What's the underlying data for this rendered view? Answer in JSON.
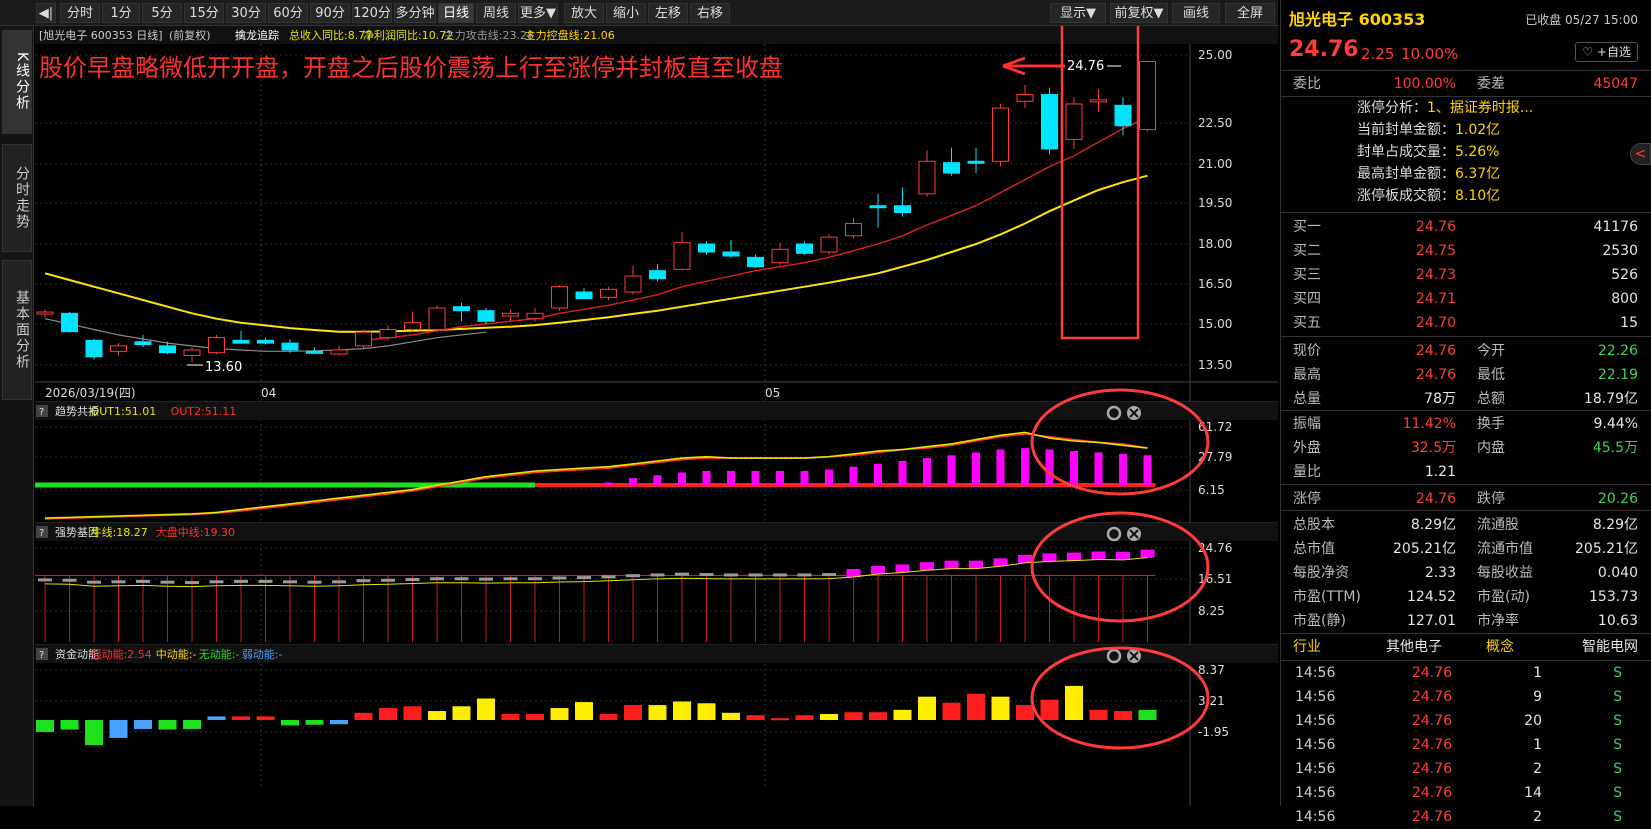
{
  "toolbar": {
    "collapse_icon": "◀|",
    "periods": [
      "分时",
      "1分",
      "5分",
      "15分",
      "30分",
      "60分",
      "90分",
      "120分",
      "多分钟",
      "日线",
      "周线",
      "更多▼"
    ],
    "active_period": "日线",
    "actions": [
      "放大",
      "缩小",
      "左移",
      "右移"
    ],
    "right": [
      "显示▼",
      "前复权▼",
      "画线",
      "全屏"
    ]
  },
  "left_tabs": [
    {
      "label": "K线分析",
      "active": true
    },
    {
      "label": "分时走势",
      "active": false
    },
    {
      "label": "基本面分析",
      "active": false
    }
  ],
  "main_chart": {
    "legend_prefix": "[旭光电子 600353 日线]",
    "adjust": "(前复权)",
    "indicator_name": "擒龙追踪",
    "legend_items": [
      {
        "text": "总收入同比:8.77",
        "color": "#e6e600"
      },
      {
        "text": "净利润同比:10.72",
        "color": "#e6e600"
      },
      {
        "text": "主力攻击线:23.28",
        "color": "#9a9a9a"
      },
      {
        "text": "主力控盘线:21.06",
        "color": "#ffd400"
      }
    ],
    "annotation": "股价早盘略微低开开盘，开盘之后股价震荡上行至涨停并封板直至收盘",
    "high_label": "24.76",
    "low_label": "13.60",
    "y_ticks": [
      "25.00",
      "22.50",
      "21.00",
      "19.50",
      "18.00",
      "16.50",
      "15.00",
      "13.50"
    ],
    "date_labels": [
      "2026/03/19(四)",
      "04",
      "05"
    ]
  },
  "chart_data": {
    "type": "candlestick",
    "ylim": [
      13.5,
      25.0
    ],
    "candles": [
      {
        "o": 15.4,
        "h": 15.55,
        "l": 15.25,
        "c": 15.45
      },
      {
        "o": 15.4,
        "h": 15.45,
        "l": 14.7,
        "c": 14.72
      },
      {
        "o": 14.4,
        "h": 14.45,
        "l": 13.7,
        "c": 13.8
      },
      {
        "o": 14.0,
        "h": 14.3,
        "l": 13.85,
        "c": 14.2
      },
      {
        "o": 14.35,
        "h": 14.6,
        "l": 14.15,
        "c": 14.25
      },
      {
        "o": 14.2,
        "h": 14.35,
        "l": 13.9,
        "c": 13.95
      },
      {
        "o": 13.85,
        "h": 14.15,
        "l": 13.6,
        "c": 14.05
      },
      {
        "o": 13.95,
        "h": 14.6,
        "l": 13.9,
        "c": 14.5
      },
      {
        "o": 14.4,
        "h": 14.75,
        "l": 14.3,
        "c": 14.3
      },
      {
        "o": 14.4,
        "h": 14.5,
        "l": 14.25,
        "c": 14.3
      },
      {
        "o": 14.3,
        "h": 14.45,
        "l": 13.95,
        "c": 14.05
      },
      {
        "o": 14.0,
        "h": 14.15,
        "l": 13.9,
        "c": 13.95
      },
      {
        "o": 13.9,
        "h": 14.2,
        "l": 13.85,
        "c": 14.05
      },
      {
        "o": 14.2,
        "h": 14.8,
        "l": 14.1,
        "c": 14.7
      },
      {
        "o": 14.5,
        "h": 14.95,
        "l": 14.4,
        "c": 14.8
      },
      {
        "o": 14.8,
        "h": 15.45,
        "l": 14.7,
        "c": 15.05
      },
      {
        "o": 14.8,
        "h": 15.7,
        "l": 14.7,
        "c": 15.6
      },
      {
        "o": 15.65,
        "h": 15.8,
        "l": 15.1,
        "c": 15.5
      },
      {
        "o": 15.5,
        "h": 15.6,
        "l": 15.0,
        "c": 15.1
      },
      {
        "o": 15.3,
        "h": 15.55,
        "l": 15.1,
        "c": 15.4
      },
      {
        "o": 15.2,
        "h": 15.6,
        "l": 15.1,
        "c": 15.4
      },
      {
        "o": 15.6,
        "h": 16.45,
        "l": 15.5,
        "c": 16.4
      },
      {
        "o": 16.2,
        "h": 16.35,
        "l": 15.95,
        "c": 15.95
      },
      {
        "o": 16.0,
        "h": 16.4,
        "l": 15.9,
        "c": 16.3
      },
      {
        "o": 16.2,
        "h": 17.2,
        "l": 16.1,
        "c": 16.8
      },
      {
        "o": 17.0,
        "h": 17.25,
        "l": 16.6,
        "c": 16.7
      },
      {
        "o": 17.05,
        "h": 18.45,
        "l": 17.0,
        "c": 18.05
      },
      {
        "o": 18.0,
        "h": 18.1,
        "l": 17.6,
        "c": 17.7
      },
      {
        "o": 17.7,
        "h": 18.15,
        "l": 17.5,
        "c": 17.55
      },
      {
        "o": 17.5,
        "h": 17.6,
        "l": 17.1,
        "c": 17.15
      },
      {
        "o": 17.3,
        "h": 18.05,
        "l": 17.2,
        "c": 17.8
      },
      {
        "o": 18.0,
        "h": 18.1,
        "l": 17.6,
        "c": 17.65
      },
      {
        "o": 17.7,
        "h": 18.35,
        "l": 17.6,
        "c": 18.25
      },
      {
        "o": 18.3,
        "h": 18.95,
        "l": 18.2,
        "c": 18.75
      },
      {
        "o": 19.4,
        "h": 19.85,
        "l": 18.6,
        "c": 19.35
      },
      {
        "o": 19.4,
        "h": 20.1,
        "l": 19.0,
        "c": 19.15
      },
      {
        "o": 19.85,
        "h": 21.5,
        "l": 19.75,
        "c": 21.1
      },
      {
        "o": 21.05,
        "h": 21.6,
        "l": 20.55,
        "c": 20.65
      },
      {
        "o": 21.1,
        "h": 21.6,
        "l": 20.65,
        "c": 21.05
      },
      {
        "o": 21.1,
        "h": 23.2,
        "l": 20.9,
        "c": 23.05
      },
      {
        "o": 23.3,
        "h": 23.9,
        "l": 23.05,
        "c": 23.55
      },
      {
        "o": 23.55,
        "h": 23.8,
        "l": 21.35,
        "c": 21.55
      },
      {
        "o": 21.9,
        "h": 23.45,
        "l": 21.55,
        "c": 23.2
      },
      {
        "o": 23.3,
        "h": 23.75,
        "l": 22.9,
        "c": 23.35
      },
      {
        "o": 23.15,
        "h": 23.45,
        "l": 22.05,
        "c": 22.4
      },
      {
        "o": 22.26,
        "h": 24.76,
        "l": 22.19,
        "c": 24.76
      }
    ],
    "ma_yellow": [
      16.9,
      16.65,
      16.4,
      16.15,
      15.9,
      15.65,
      15.4,
      15.2,
      15.05,
      14.95,
      14.85,
      14.78,
      14.72,
      14.72,
      14.73,
      14.75,
      14.78,
      14.82,
      14.86,
      14.9,
      14.96,
      15.05,
      15.15,
      15.25,
      15.38,
      15.5,
      15.65,
      15.8,
      15.95,
      16.1,
      16.25,
      16.4,
      16.55,
      16.72,
      16.9,
      17.15,
      17.4,
      17.7,
      18.0,
      18.35,
      18.75,
      19.2,
      19.6,
      20.0,
      20.3,
      20.55
    ],
    "ma_red": [
      null,
      null,
      null,
      null,
      null,
      null,
      null,
      null,
      null,
      null,
      null,
      null,
      null,
      14.4,
      14.5,
      14.6,
      14.75,
      14.9,
      15.0,
      15.1,
      15.2,
      15.4,
      15.55,
      15.7,
      15.9,
      16.1,
      16.4,
      16.6,
      16.8,
      17.0,
      17.15,
      17.3,
      17.5,
      17.75,
      18.0,
      18.3,
      18.7,
      19.05,
      19.4,
      19.9,
      20.4,
      20.9,
      21.3,
      21.8,
      22.3,
      22.7
    ],
    "ma_gray": [
      15.2,
      15.0,
      14.8,
      14.6,
      14.45,
      14.3,
      14.2,
      14.1,
      14.05,
      14.0,
      14.0,
      14.02,
      14.05,
      14.1,
      14.2,
      14.35,
      14.5,
      14.6,
      14.7,
      null,
      null,
      null,
      null,
      null,
      null,
      null,
      null,
      null,
      null,
      null,
      null,
      null,
      null,
      null,
      null,
      null,
      null,
      null,
      null,
      null,
      null,
      null,
      null,
      null,
      null,
      null
    ]
  },
  "sub1": {
    "name": "趋势共振",
    "out1_label": "OUT1:51.01",
    "out2_label": "OUT2:51.11",
    "y_ticks": [
      "61.72",
      "27.79",
      "6.15"
    ],
    "ylim": [
      0,
      70
    ],
    "green_bar_level": 12,
    "out1": [
      2,
      2.5,
      3,
      3.5,
      4,
      4.5,
      5,
      6,
      8,
      10,
      12,
      14,
      16,
      18,
      20,
      22,
      25,
      28,
      31,
      33,
      35,
      36,
      37,
      38,
      40,
      42,
      44,
      45,
      44,
      44,
      44,
      44,
      45,
      47,
      49,
      50,
      52,
      54,
      57,
      60,
      62,
      58,
      56,
      55,
      53,
      51.01
    ],
    "out2": [
      1.5,
      2,
      2.5,
      3,
      3.5,
      4,
      4.5,
      5.5,
      7,
      9,
      11,
      13,
      15,
      17,
      19,
      21,
      24,
      27,
      30,
      32,
      34,
      35,
      36,
      37,
      39,
      41,
      43,
      44,
      44,
      44,
      44,
      44,
      45,
      46,
      48,
      50,
      51,
      53,
      56,
      59,
      61,
      59,
      57,
      55,
      54,
      51.11
    ],
    "bars": [
      null,
      null,
      null,
      null,
      null,
      null,
      null,
      null,
      null,
      null,
      null,
      null,
      null,
      null,
      null,
      null,
      null,
      null,
      null,
      null,
      null,
      20,
      24,
      27,
      30,
      32,
      34,
      35,
      35,
      35,
      35,
      35,
      36,
      38,
      40,
      42,
      44,
      46,
      48,
      50,
      51,
      50,
      49,
      48,
      47,
      46
    ]
  },
  "sub2": {
    "name": "强势基因",
    "niu_label": "牛线:18.27",
    "dapan_label": "大盘中线:19.30",
    "y_ticks": [
      "24.76",
      "16.51",
      "8.25"
    ],
    "ylim": [
      6.0,
      28.0
    ],
    "ref_line": 17.6,
    "values": [
      16.4,
      16.3,
      15.8,
      15.9,
      16.0,
      15.8,
      15.7,
      15.9,
      16.0,
      16.0,
      15.9,
      15.8,
      15.9,
      16.2,
      16.3,
      16.5,
      16.7,
      16.7,
      16.6,
      16.7,
      16.7,
      16.9,
      17.0,
      17.2,
      17.5,
      17.7,
      17.9,
      17.8,
      17.7,
      17.7,
      17.7,
      17.7,
      17.8,
      18.2,
      19.0,
      19.4,
      20.0,
      20.4,
      20.4,
      21.0,
      21.9,
      22.3,
      22.5,
      22.8,
      22.7,
      23.3
    ]
  },
  "sub3": {
    "name": "资金动能",
    "strong_label": "强动能:2.54",
    "mid_label": "中动能:-",
    "none_label": "无动能:-",
    "weak_label": "弱动能:-",
    "y_ticks": [
      "8.37",
      "3.21",
      "-1.95"
    ],
    "ylim": [
      -4.5,
      9.0
    ],
    "values": [
      -2.0,
      -1.6,
      -4.2,
      -3.0,
      -1.5,
      -1.6,
      -1.5,
      0.6,
      0.6,
      0.6,
      -0.9,
      -0.8,
      -0.7,
      1.2,
      2.0,
      2.3,
      1.5,
      2.3,
      3.6,
      1.0,
      1.0,
      2.0,
      3.0,
      1.0,
      2.5,
      2.5,
      3.1,
      2.8,
      1.2,
      0.8,
      0.3,
      0.8,
      1.0,
      1.3,
      1.3,
      1.7,
      3.9,
      2.9,
      4.4,
      3.9,
      2.5,
      3.4,
      5.7,
      1.7,
      1.5,
      1.7,
      0.2,
      2.54
    ],
    "colors": [
      "green",
      "green",
      "green",
      "blue",
      "blue",
      "green",
      "green",
      "blue",
      "red",
      "red",
      "green",
      "green",
      "blue",
      "red",
      "red",
      "red",
      "yellow",
      "yellow",
      "yellow",
      "red",
      "red",
      "yellow",
      "yellow",
      "red",
      "red",
      "yellow",
      "yellow",
      "yellow",
      "yellow",
      "red",
      "red",
      "red",
      "yellow",
      "red",
      "red",
      "yellow",
      "yellow",
      "red",
      "red",
      "yellow",
      "red",
      "red",
      "yellow",
      "red",
      "red",
      "green",
      "red"
    ]
  },
  "right": {
    "stock_name": "旭光电子 600353",
    "status": "已收盘 05/27 15:00",
    "price": "24.76",
    "change": "2.25",
    "change_pct": "10.00%",
    "fav": "♡ +自选",
    "weibi_label": "委比",
    "weibi": "100.00%",
    "weicha_label": "委差",
    "weicha": "45047",
    "zt_analysis": [
      {
        "label": "涨停分析：",
        "value": "1、据证券时报..."
      },
      {
        "label": "当前封单金额：",
        "value": "1.02亿"
      },
      {
        "label": "封单占成交量：",
        "value": "5.26%"
      },
      {
        "label": "最高封单金额：",
        "value": "6.37亿"
      },
      {
        "label": "涨停板成交额：",
        "value": "8.10亿"
      }
    ],
    "bids": [
      {
        "label": "买一",
        "price": "24.76",
        "vol": "41176"
      },
      {
        "label": "买二",
        "price": "24.75",
        "vol": "2530"
      },
      {
        "label": "买三",
        "price": "24.73",
        "vol": "526"
      },
      {
        "label": "买四",
        "price": "24.71",
        "vol": "800"
      },
      {
        "label": "买五",
        "price": "24.70",
        "vol": "15"
      }
    ],
    "quote_rows": [
      [
        {
          "l": "现价",
          "v": "24.76",
          "c": "red"
        },
        {
          "l": "今开",
          "v": "22.26",
          "c": "green"
        }
      ],
      [
        {
          "l": "最高",
          "v": "24.76",
          "c": "red"
        },
        {
          "l": "最低",
          "v": "22.19",
          "c": "green"
        }
      ],
      [
        {
          "l": "总量",
          "v": "78万",
          "c": "white"
        },
        {
          "l": "总额",
          "v": "18.79亿",
          "c": "white"
        }
      ]
    ],
    "quote_rows2": [
      [
        {
          "l": "振幅",
          "v": "11.42%",
          "c": "red"
        },
        {
          "l": "换手",
          "v": "9.44%",
          "c": "white"
        }
      ],
      [
        {
          "l": "外盘",
          "v": "32.5万",
          "c": "red"
        },
        {
          "l": "内盘",
          "v": "45.5万",
          "c": "green"
        }
      ],
      [
        {
          "l": "量比",
          "v": "1.21",
          "c": "white"
        }
      ]
    ],
    "limit_row": [
      {
        "l": "涨停",
        "v": "24.76",
        "c": "red"
      },
      {
        "l": "跌停",
        "v": "20.26",
        "c": "green"
      }
    ],
    "fund_rows": [
      [
        {
          "l": "总股本",
          "v": "8.29亿"
        },
        {
          "l": "流通股",
          "v": "8.29亿"
        }
      ],
      [
        {
          "l": "总市值",
          "v": "205.21亿"
        },
        {
          "l": "流通市值",
          "v": "205.21亿"
        }
      ],
      [
        {
          "l": "每股净资",
          "v": "2.33"
        },
        {
          "l": "每股收益",
          "v": "0.040"
        }
      ],
      [
        {
          "l": "市盈(TTM)",
          "v": "124.52"
        },
        {
          "l": "市盈(动)",
          "v": "153.73"
        }
      ],
      [
        {
          "l": "市盈(静)",
          "v": "127.01"
        },
        {
          "l": "市净率",
          "v": "10.63"
        }
      ]
    ],
    "industry": {
      "label": "行业",
      "value": "其他电子",
      "concept_label": "概念",
      "concept": "智能电网"
    },
    "ticks": [
      {
        "t": "14:56",
        "p": "24.76",
        "v": "1",
        "d": "S"
      },
      {
        "t": "14:56",
        "p": "24.76",
        "v": "9",
        "d": "S"
      },
      {
        "t": "14:56",
        "p": "24.76",
        "v": "20",
        "d": "S"
      },
      {
        "t": "14:56",
        "p": "24.76",
        "v": "1",
        "d": "S"
      },
      {
        "t": "14:56",
        "p": "24.76",
        "v": "2",
        "d": "S"
      },
      {
        "t": "14:56",
        "p": "24.76",
        "v": "14",
        "d": "S"
      },
      {
        "t": "14:56",
        "p": "24.76",
        "v": "2",
        "d": "S"
      }
    ],
    "handle": "<"
  },
  "colors": {
    "up": "#ff3b3b",
    "down": "#00e5ff",
    "ma_yellow": "#ffe600",
    "ma_red": "#e02020",
    "magenta": "#ff00ff",
    "green_bar": "#1fe01f",
    "annotation": "#ff3030",
    "circle": "#ff3b3b"
  }
}
